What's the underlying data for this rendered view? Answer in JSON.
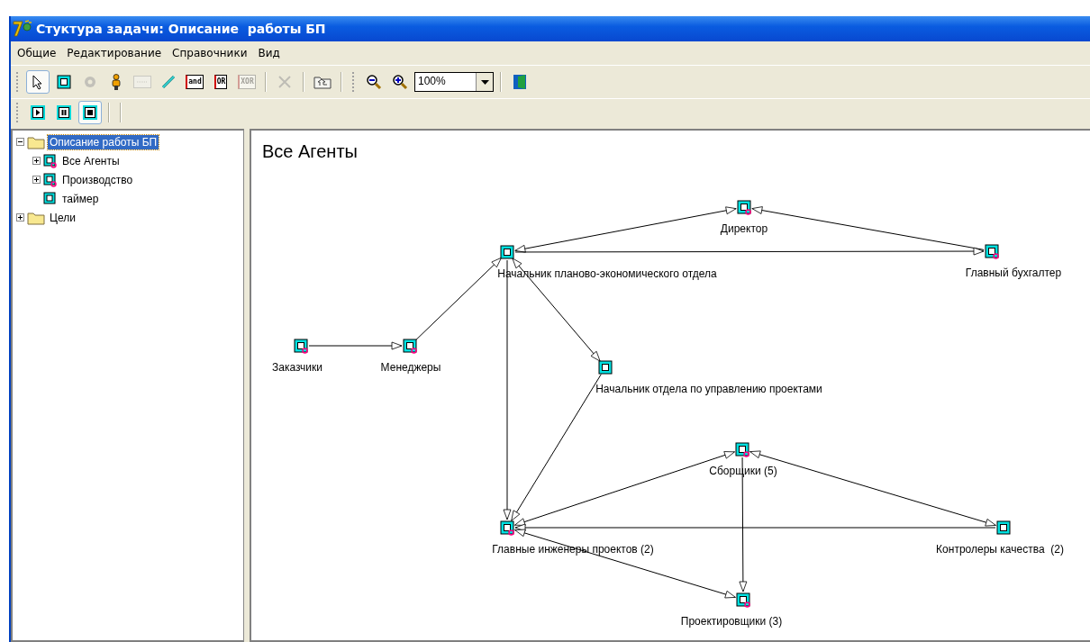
{
  "window": {
    "title": "Стуктура задачи: Описание  работы БП"
  },
  "menu": [
    "Общие",
    "Редактирование",
    "Справочники",
    "Вид"
  ],
  "toolbar": {
    "tools": [
      {
        "kind": "pointer",
        "selected": true,
        "disabled": false
      },
      {
        "kind": "agent",
        "selected": false,
        "disabled": false
      },
      {
        "kind": "gear",
        "selected": false,
        "disabled": true
      },
      {
        "kind": "person",
        "selected": false,
        "disabled": false
      },
      {
        "kind": "panel",
        "selected": false,
        "disabled": true
      },
      {
        "kind": "pen",
        "selected": false,
        "disabled": false
      },
      {
        "kind": "gate",
        "label": "and",
        "selected": false,
        "disabled": false
      },
      {
        "kind": "gate",
        "label": "OR",
        "selected": false,
        "disabled": false
      },
      {
        "kind": "gate",
        "label": "XOR",
        "selected": false,
        "disabled": true
      },
      {
        "kind": "separator"
      },
      {
        "kind": "delete",
        "selected": false,
        "disabled": true
      },
      {
        "kind": "separator"
      },
      {
        "kind": "folder-up",
        "selected": false,
        "disabled": false
      }
    ],
    "zoom_tools": [
      {
        "kind": "zoom-out"
      },
      {
        "kind": "zoom-in"
      }
    ],
    "zoom": {
      "value": "100%"
    },
    "end_tools": [
      {
        "kind": "exit"
      }
    ]
  },
  "playback": [
    {
      "kind": "play",
      "selected": false
    },
    {
      "kind": "pause",
      "selected": false
    },
    {
      "kind": "stop",
      "selected": true
    }
  ],
  "tree": [
    {
      "label": "Описание работы БП",
      "kind": "folder",
      "selected": true,
      "expanded": true,
      "children": [
        {
          "label": "Все Агенты",
          "kind": "agent-group",
          "selected": false,
          "expanded": false
        },
        {
          "label": "Производство",
          "kind": "agent-group",
          "selected": false,
          "expanded": false
        },
        {
          "label": "таймер",
          "kind": "agent",
          "selected": false
        }
      ]
    },
    {
      "label": "Цели",
      "kind": "folder",
      "selected": false,
      "expanded": false
    }
  ],
  "diagram": {
    "title": "Все Агенты",
    "nodes": [
      {
        "label": "Директор",
        "marked": true
      },
      {
        "label": "Начальник планово-экономического отдела",
        "marked": false
      },
      {
        "label": "Главный бухгалтер",
        "marked": true
      },
      {
        "label": "Заказчики",
        "marked": true
      },
      {
        "label": "Менеджеры",
        "marked": true
      },
      {
        "label": "Начальник отдела по управлению проектами",
        "marked": false
      },
      {
        "label": "Сборщики (5)",
        "marked": true
      },
      {
        "label": "Главные инженеры проектов (2)",
        "marked": true
      },
      {
        "label": "Контролеры качества  (2)",
        "marked": false
      },
      {
        "label": "Проектировщики (3)",
        "marked": true
      }
    ]
  }
}
